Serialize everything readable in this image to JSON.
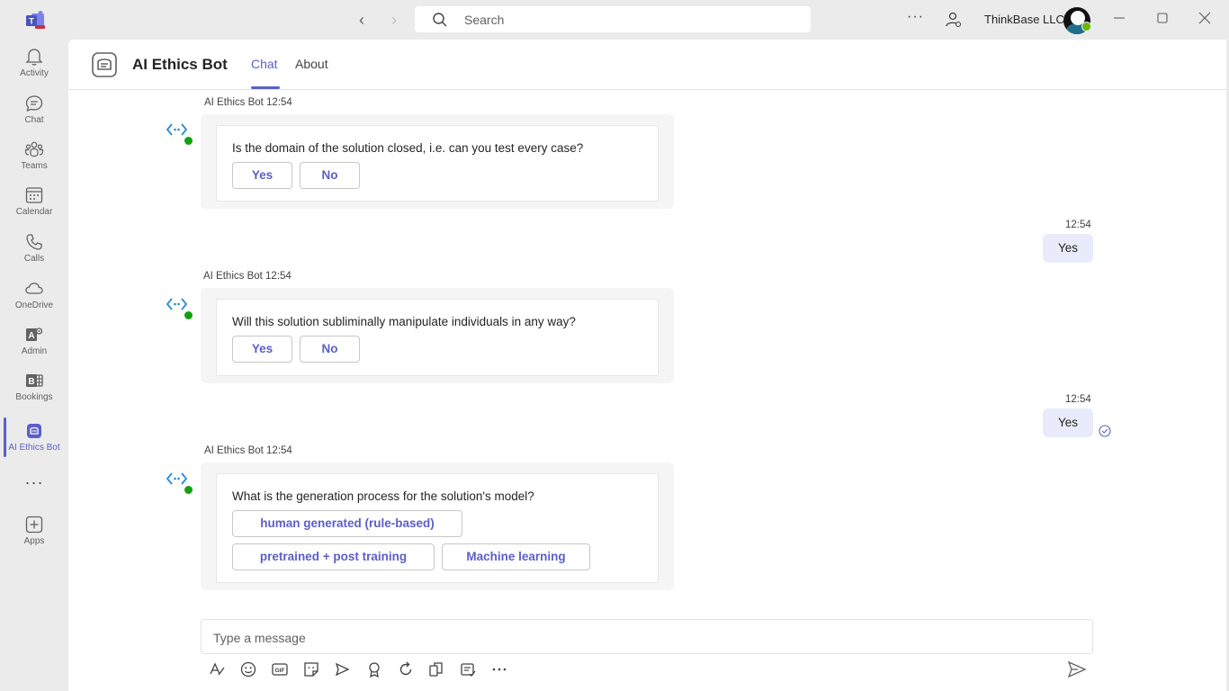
{
  "window": {
    "search_placeholder": "Search",
    "org_name": "ThinkBase LLC",
    "more_label": "···"
  },
  "rail": {
    "items": [
      {
        "label": "Activity",
        "icon": "bell-icon"
      },
      {
        "label": "Chat",
        "icon": "chat-icon"
      },
      {
        "label": "Teams",
        "icon": "teams-icon"
      },
      {
        "label": "Calendar",
        "icon": "calendar-icon"
      },
      {
        "label": "Calls",
        "icon": "phone-icon"
      },
      {
        "label": "OneDrive",
        "icon": "cloud-icon"
      },
      {
        "label": "Admin",
        "icon": "admin-icon"
      },
      {
        "label": "Bookings",
        "icon": "bookings-icon"
      },
      {
        "label": "AI Ethics Bot",
        "icon": "bot-app-icon"
      }
    ],
    "more_label": "···",
    "apps_label": "Apps",
    "accent_color": "#5b5fc7"
  },
  "header": {
    "title": "AI Ethics Bot",
    "tabs": [
      "Chat",
      "About"
    ],
    "active_tab": "Chat"
  },
  "messages": [
    {
      "meta": "AI Ethics Bot 12:54",
      "question": "Is the domain of the solution closed, i.e. can you test every case?",
      "buttons": [
        "Yes",
        "No"
      ]
    },
    {
      "meta": "AI Ethics Bot 12:54",
      "question": "Will this solution subliminally manipulate individuals in any way?",
      "buttons": [
        "Yes",
        "No"
      ]
    },
    {
      "meta": "AI Ethics Bot 12:54",
      "question": "What is the generation process for the solution's model?",
      "buttons": [
        "human generated (rule-based)",
        "pretrained + post training",
        "Machine learning"
      ]
    }
  ],
  "replies": [
    {
      "time": "12:54",
      "text": "Yes"
    },
    {
      "time": "12:54",
      "text": "Yes"
    }
  ],
  "composer": {
    "placeholder": "Type a message"
  }
}
